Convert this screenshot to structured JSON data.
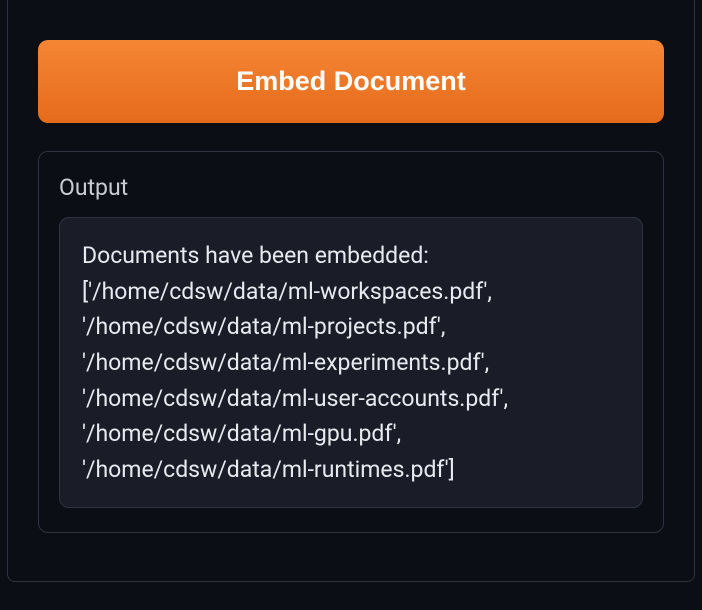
{
  "embed_button_label": "Embed Document",
  "output": {
    "label": "Output",
    "text": "Documents have been embedded: ['/home/cdsw/data/ml-workspaces.pdf', '/home/cdsw/data/ml-projects.pdf', '/home/cdsw/data/ml-experiments.pdf', '/home/cdsw/data/ml-user-accounts.pdf', '/home/cdsw/data/ml-gpu.pdf', '/home/cdsw/data/ml-runtimes.pdf']"
  }
}
